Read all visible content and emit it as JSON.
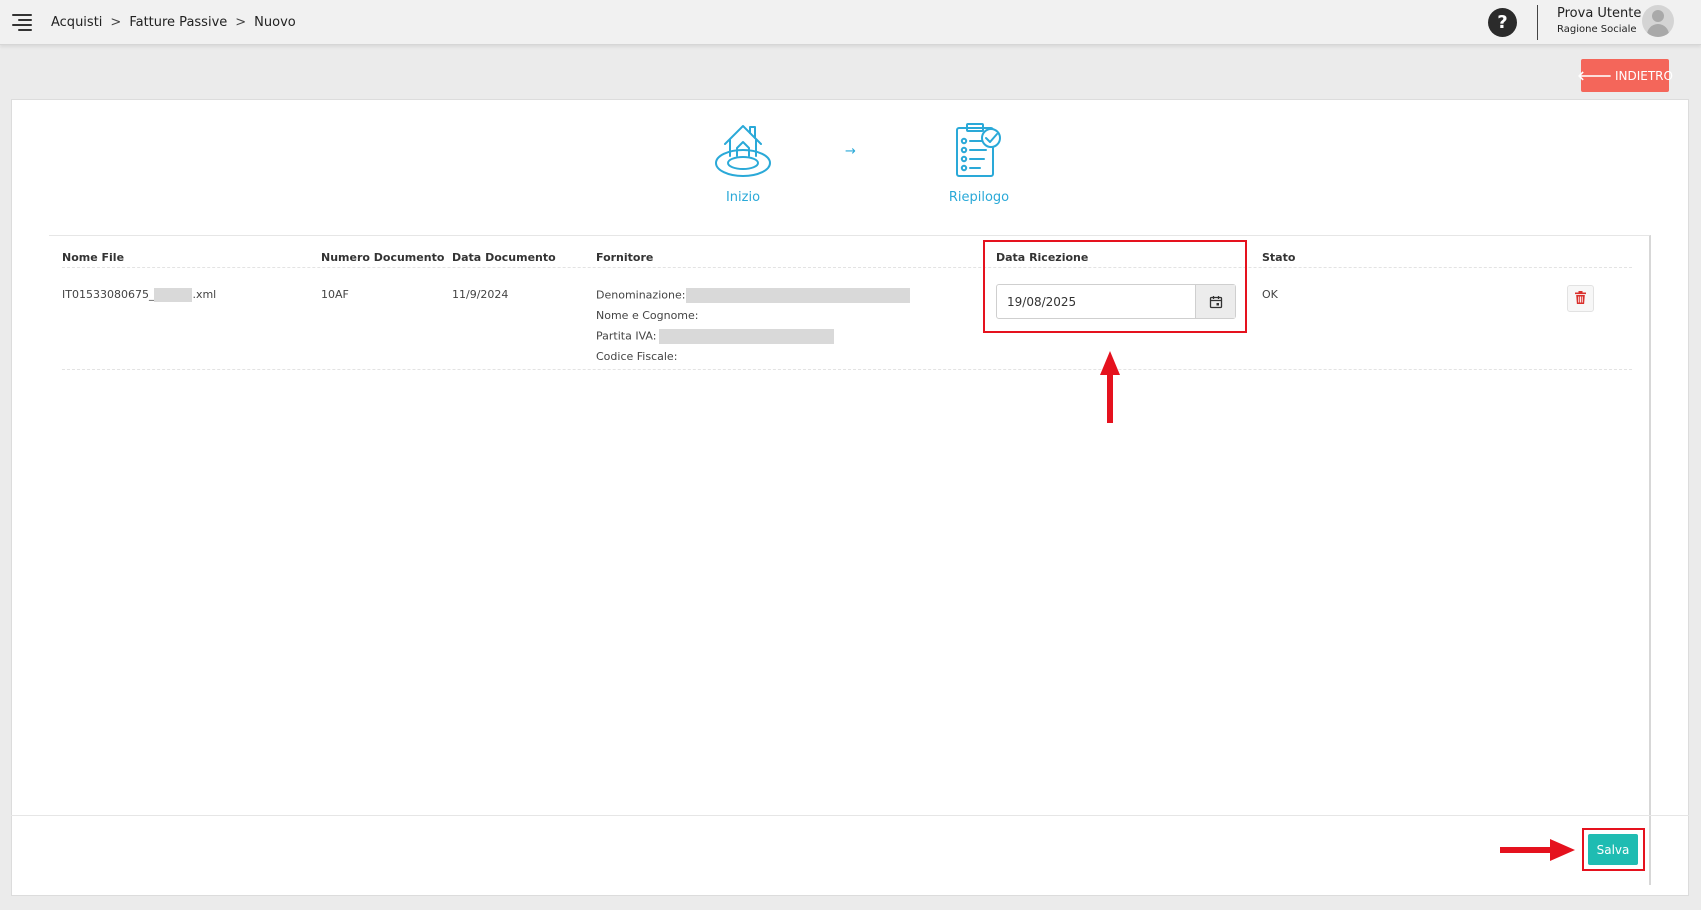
{
  "header": {
    "breadcrumb": [
      "Acquisti",
      "Fatture Passive",
      "Nuovo"
    ],
    "breadcrumb_separator": ">",
    "help_label": "?",
    "user_name": "Prova Utente",
    "user_company": "Ragione Sociale"
  },
  "toolbar": {
    "back_label": "INDIETRO",
    "back_icon": "arrow-left-icon"
  },
  "wizard": {
    "steps": [
      {
        "label": "Inizio",
        "icon": "home-upload-icon"
      },
      {
        "label": "Riepilogo",
        "icon": "checklist-icon"
      }
    ],
    "arrow": "→"
  },
  "table": {
    "columns": [
      "Nome File",
      "Numero Documento",
      "Data Documento",
      "Fornitore",
      "Data Ricezione",
      "Stato"
    ],
    "rows": [
      {
        "nome_file_prefix": "IT01533080675_",
        "nome_file_suffix": ".xml",
        "numero_documento": "10AF",
        "data_documento": "11/9/2024",
        "fornitore": {
          "denominazione_label": "Denominazione:",
          "nome_cognome_label": "Nome e Cognome:",
          "partita_iva_label": "Partita IVA:",
          "codice_fiscale_label": "Codice Fiscale:"
        },
        "data_ricezione": "19/08/2025",
        "stato": "OK"
      }
    ]
  },
  "footer": {
    "save_label": "Salva"
  },
  "colors": {
    "accent": "#2aa9d8",
    "back_button": "#f4665a",
    "save_button": "#1fbcb2",
    "annotation": "#e5121e",
    "delete_icon": "#d9302c"
  }
}
